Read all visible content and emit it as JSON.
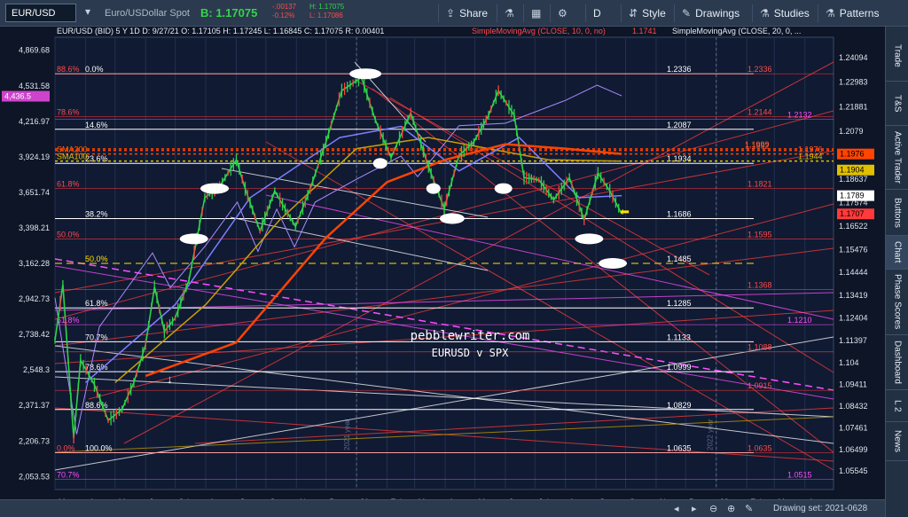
{
  "toolbar": {
    "symbol": "EUR/USD",
    "symbol_name": "Euro/USDollar Spot",
    "bid": "B: 1.17075",
    "change": "-.00137",
    "change_pct": "-0.12%",
    "hi": "H: 1.17075",
    "lo": "L: 1.17086",
    "share": "Share",
    "interval": "D",
    "style": "Style",
    "drawings": "Drawings",
    "studies": "Studies",
    "patterns": "Patterns"
  },
  "sidebar": {
    "tabs": [
      "Trade",
      "T&S",
      "Active Trader",
      "Buttons",
      "Chart",
      "Phase Scores",
      "Dashboard",
      "L 2",
      "News"
    ],
    "active": "Chart"
  },
  "chart_header": {
    "info": "EUR/USD (BID) 5 Y 1D   D: 9/27/21   O: 1.17105   H: 1.17245   L: 1.16845   C: 1.17075   R: 0.00401",
    "study1": "SimpleMovingAvg (CLOSE, 10, 0, no)",
    "study1_val": "1.1741",
    "study2": "SimpleMovingAvg (CLOSE, 20, 0, ..."
  },
  "watermark": {
    "site": "pebblewriter.com",
    "subtitle": "EURUSD v SPX"
  },
  "footer": {
    "drawing_set": "Drawing set: 2021-0628"
  },
  "colors": {
    "background": "#0d1526",
    "fib_white": "#ffffff",
    "fib_red": "#ff3a3a",
    "fib_magenta": "#ff4dff",
    "sma200": "#ff4400",
    "sma100": "#c8a000",
    "sma50": "#7f7fff",
    "spx": "#a98bff",
    "cyan_price": "#35d44a"
  },
  "chart_data": {
    "type": "line",
    "title": "EUR/USD (BID) 5 Y 1D",
    "x_ticks": [
      "Mar",
      "Apr",
      "May",
      "Jun",
      "Jul",
      "Aug",
      "Sep",
      "Oct",
      "Nov",
      "Dec",
      "21",
      "Feb",
      "Mar",
      "Apr",
      "May",
      "Jun",
      "Jul",
      "Aug",
      "Sep",
      "Oct",
      "Nov",
      "Dec",
      "22",
      "Feb",
      "Mar",
      "Apr"
    ],
    "year_labels": [
      "2021 year",
      "2022 year"
    ],
    "x_range": [
      "2020-03-01",
      "2022-04-30"
    ],
    "right_axis": {
      "label": "EUR/USD",
      "range": [
        1.047,
        1.25
      ],
      "ticks": [
        "1.24094",
        "1.22983",
        "1.21881",
        "1.2079",
        "1.19707",
        "1.18637",
        "1.17574",
        "1.16522",
        "1.15476",
        "1.14444",
        "1.13419",
        "1.12404",
        "1.11397",
        "1.104",
        "1.09411",
        "1.08432",
        "1.07461",
        "1.06499",
        "1.05545"
      ]
    },
    "left_axis": {
      "label": "SPX",
      "ticks": [
        "4,869.68",
        "4,531.58",
        "4,216.97",
        "3,924.19",
        "3,651.74",
        "3,398.21",
        "3,162.28",
        "2,942.73",
        "2,738.42",
        "2,548.3",
        "2,371.37",
        "2,206.73",
        "2,053.53"
      ],
      "current": "4,436.5"
    },
    "fib_levels": [
      {
        "pct": "0.0%",
        "price": "1.2336",
        "color": "white"
      },
      {
        "pct": "14.6%",
        "price": "1.2087",
        "color": "white"
      },
      {
        "pct": "23.6%",
        "price": "1.1934",
        "color": "white"
      },
      {
        "pct": "38.2%",
        "price": "1.1686",
        "color": "white"
      },
      {
        "pct": "50.0%",
        "price": "1.1485",
        "color": "yellow"
      },
      {
        "pct": "61.8%",
        "price": "1.1285",
        "color": "white"
      },
      {
        "pct": "70.7%",
        "price": "1.1133",
        "color": "white"
      },
      {
        "pct": "78.6%",
        "price": "1.0999",
        "color": "white"
      },
      {
        "pct": "88.6%",
        "price": "1.0829",
        "color": "white"
      },
      {
        "pct": "100.0%",
        "price": "1.0635",
        "color": "white"
      }
    ],
    "red_levels": [
      {
        "pct": "88.6%",
        "price": "1.2336"
      },
      {
        "pct": "78.6%",
        "price": "1.2144"
      },
      {
        "pct": "61.8%",
        "price": "1.1821"
      },
      {
        "pct": "50.0%",
        "price": "1.1595"
      },
      {
        "pct": "",
        "price": "1.1368"
      },
      {
        "pct": "",
        "price": "1.1088"
      },
      {
        "pct": "",
        "price": "1.0915"
      },
      {
        "pct": "0.0%",
        "price": "1.0635"
      }
    ],
    "magenta_levels": [
      {
        "pct": "61.8%",
        "price": "1.1210"
      },
      {
        "pct": "70.7%",
        "price": "1.0515"
      },
      {
        "pct": "",
        "price": "1.2132"
      }
    ],
    "ma_labels": [
      {
        "name": "SMA200",
        "price": "1.1976"
      },
      {
        "name": "SMA100",
        "price": "1.1944"
      },
      {
        "name": "",
        "price": "1.1999"
      },
      {
        "name": "",
        "price": "1.1992"
      }
    ],
    "right_tags": [
      {
        "value": "1.1976",
        "color": "#ff4400"
      },
      {
        "value": "1.1904",
        "color": "#e0c000"
      },
      {
        "value": "1.1789",
        "color": "#ffffff"
      },
      {
        "value": "1.1707",
        "color": "#ff3a3a"
      }
    ],
    "price_series": [
      [
        "2020-03-01",
        1.114
      ],
      [
        "2020-03-09",
        1.139
      ],
      [
        "2020-03-20",
        1.07
      ],
      [
        "2020-03-27",
        1.105
      ],
      [
        "2020-04-10",
        1.094
      ],
      [
        "2020-04-24",
        1.078
      ],
      [
        "2020-05-08",
        1.083
      ],
      [
        "2020-05-20",
        1.095
      ],
      [
        "2020-06-01",
        1.112
      ],
      [
        "2020-06-10",
        1.138
      ],
      [
        "2020-06-20",
        1.118
      ],
      [
        "2020-07-01",
        1.124
      ],
      [
        "2020-07-15",
        1.141
      ],
      [
        "2020-07-31",
        1.178
      ],
      [
        "2020-08-15",
        1.183
      ],
      [
        "2020-09-01",
        1.195
      ],
      [
        "2020-09-10",
        1.182
      ],
      [
        "2020-09-25",
        1.163
      ],
      [
        "2020-10-10",
        1.181
      ],
      [
        "2020-10-31",
        1.165
      ],
      [
        "2020-11-15",
        1.182
      ],
      [
        "2020-12-01",
        1.203
      ],
      [
        "2020-12-17",
        1.226
      ],
      [
        "2021-01-06",
        1.232
      ],
      [
        "2021-01-20",
        1.213
      ],
      [
        "2021-02-05",
        1.196
      ],
      [
        "2021-02-25",
        1.216
      ],
      [
        "2021-03-15",
        1.192
      ],
      [
        "2021-03-31",
        1.173
      ],
      [
        "2021-04-15",
        1.197
      ],
      [
        "2021-04-30",
        1.203
      ],
      [
        "2021-05-15",
        1.215
      ],
      [
        "2021-05-25",
        1.226
      ],
      [
        "2021-06-10",
        1.215
      ],
      [
        "2021-06-20",
        1.187
      ],
      [
        "2021-07-05",
        1.186
      ],
      [
        "2021-07-20",
        1.177
      ],
      [
        "2021-08-05",
        1.187
      ],
      [
        "2021-08-20",
        1.168
      ],
      [
        "2021-09-03",
        1.189
      ],
      [
        "2021-09-15",
        1.181
      ],
      [
        "2021-09-27",
        1.1707
      ]
    ],
    "sma200_series": [
      [
        "2020-06-01",
        1.098
      ],
      [
        "2020-09-01",
        1.113
      ],
      [
        "2020-12-01",
        1.16
      ],
      [
        "2021-02-01",
        1.185
      ],
      [
        "2021-04-01",
        1.195
      ],
      [
        "2021-06-01",
        1.202
      ],
      [
        "2021-08-01",
        1.2
      ],
      [
        "2021-09-27",
        1.1976
      ]
    ],
    "sma100_series": [
      [
        "2020-05-01",
        1.095
      ],
      [
        "2020-08-01",
        1.13
      ],
      [
        "2020-10-15",
        1.168
      ],
      [
        "2021-01-01",
        1.2
      ],
      [
        "2021-03-15",
        1.205
      ],
      [
        "2021-05-15",
        1.2
      ],
      [
        "2021-07-15",
        1.195
      ],
      [
        "2021-09-27",
        1.1944
      ]
    ],
    "sma50_series": [
      [
        "2020-04-01",
        1.095
      ],
      [
        "2020-07-01",
        1.13
      ],
      [
        "2020-09-15",
        1.178
      ],
      [
        "2020-12-15",
        1.205
      ],
      [
        "2021-02-15",
        1.21
      ],
      [
        "2021-04-15",
        1.19
      ],
      [
        "2021-06-15",
        1.205
      ],
      [
        "2021-08-15",
        1.178
      ],
      [
        "2021-09-27",
        1.1789
      ]
    ],
    "spx_series": [
      [
        "2020-03-01",
        2950
      ],
      [
        "2020-03-23",
        2237
      ],
      [
        "2020-04-15",
        2780
      ],
      [
        "2020-06-08",
        3230
      ],
      [
        "2020-06-26",
        3010
      ],
      [
        "2020-08-01",
        3280
      ],
      [
        "2020-09-02",
        3580
      ],
      [
        "2020-09-23",
        3240
      ],
      [
        "2020-10-12",
        3530
      ],
      [
        "2020-10-30",
        3270
      ],
      [
        "2020-11-20",
        3580
      ],
      [
        "2021-01-01",
        3750
      ],
      [
        "2021-02-15",
        3930
      ],
      [
        "2021-03-04",
        3770
      ],
      [
        "2021-04-15",
        4180
      ],
      [
        "2021-06-01",
        4200
      ],
      [
        "2021-08-01",
        4400
      ],
      [
        "2021-09-02",
        4537
      ],
      [
        "2021-09-27",
        4440
      ]
    ]
  }
}
